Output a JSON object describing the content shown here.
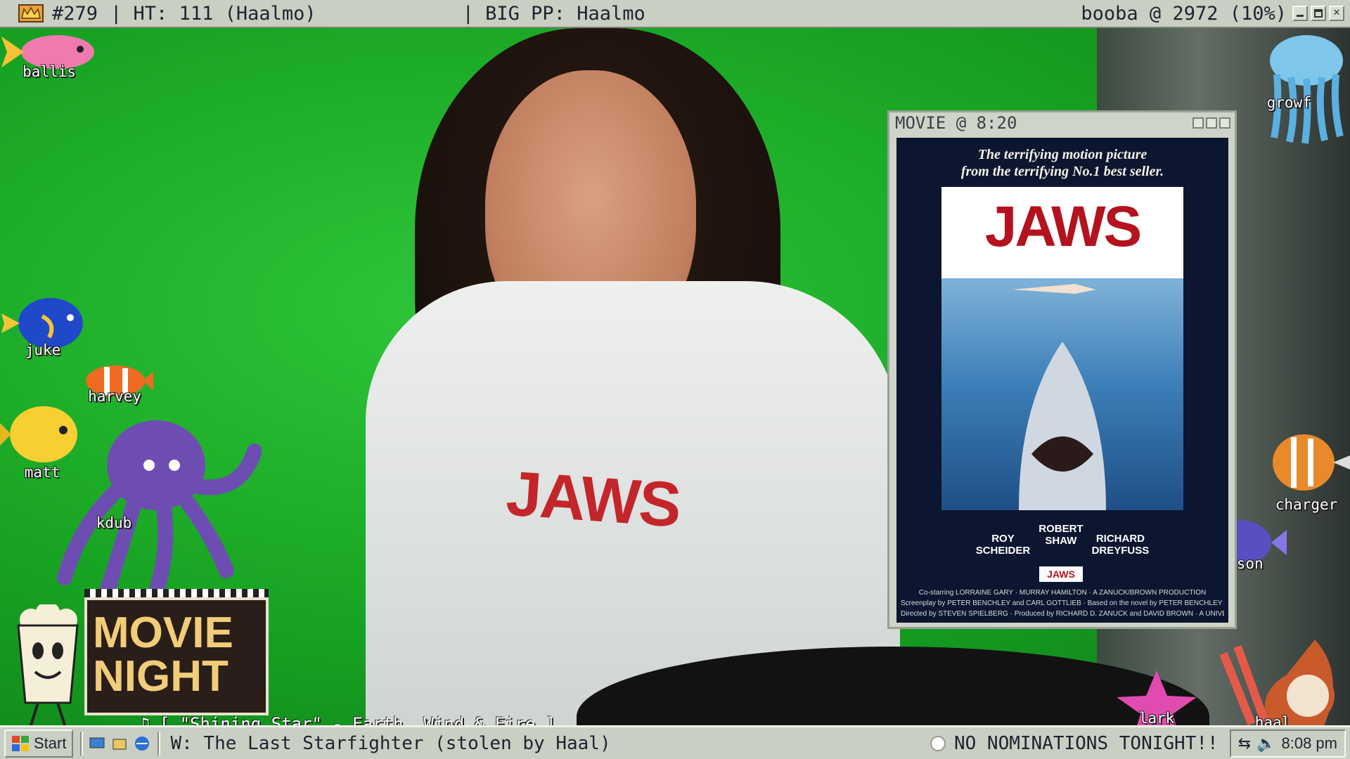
{
  "topbar": {
    "ticket": "#279",
    "ht": "| HT: 111 (Haalmo)",
    "big_pp": "| BIG PP: Haalmo",
    "status": "booba @ 2972 (10%)"
  },
  "movie_window": {
    "title": "MOVIE @ 8:20",
    "tagline_1": "The terrifying motion picture",
    "tagline_2": "from the terrifying No.1 best seller.",
    "poster_title": "JAWS",
    "credit_1a": "ROY",
    "credit_1b": "SCHEIDER",
    "credit_2a": "ROBERT",
    "credit_2b": "SHAW",
    "credit_3a": "RICHARD",
    "credit_3b": "DREYFUSS",
    "mini_logo": "JAWS",
    "fine_1": "Co-starring LORRAINE GARY · MURRAY HAMILTON · A ZANUCK/BROWN PRODUCTION",
    "fine_2": "Screenplay by PETER BENCHLEY and CARL GOTTLIEB · Based on the novel by PETER BENCHLEY · Music by JOHN WILLIAMS",
    "fine_3": "Directed by STEVEN SPIELBERG · Produced by RICHARD D. ZANUCK and DAVID BROWN · A UNIVERSAL PICTURE"
  },
  "shirt_text": "JAWS",
  "critters": {
    "ballis": "ballis",
    "growf": "growf",
    "juke": "juke",
    "harvey": "harvey",
    "matt": "matt",
    "kdub": "kdub",
    "charger": "charger",
    "bison": "bison",
    "lark": "lark",
    "haal": "haal"
  },
  "movie_night": {
    "line1": "MOVIE",
    "line2": "NIGHT"
  },
  "now_playing": "[ \"Shining Star\" - Earth, Wind & Fire ]",
  "taskbar": {
    "start": "Start",
    "window_task": "W: The Last Starfighter (stolen by Haal)",
    "notice": "NO NOMINATIONS TONIGHT!!",
    "clock": "8:08 pm"
  },
  "colors": {
    "green_screen": "#1aa326",
    "chrome": "#c9cfc2",
    "jaws_red": "#b3121e",
    "poster_navy": "#0c1630"
  },
  "icons": [
    "crown-icon",
    "minimize-icon",
    "maximize-icon",
    "close-icon",
    "music-note-icon",
    "windows-logo-icon",
    "tray-network-icon",
    "tray-speaker-icon"
  ]
}
